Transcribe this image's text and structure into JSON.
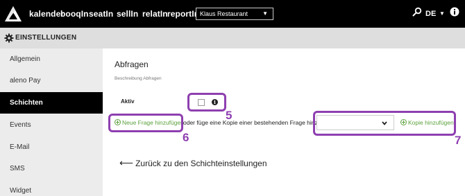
{
  "topbar": {
    "nav": [
      "kalender",
      "booqIn",
      "seatIn",
      "sellIn",
      "relatIn",
      "reportIn"
    ],
    "restaurant": "Klaus Restaurant",
    "language": "DE",
    "icons": [
      "logo-icon",
      "search-icon",
      "chevron-down-icon",
      "info-icon"
    ]
  },
  "subheader": {
    "title": "EINSTELLUNGEN",
    "icon": "gear-icon"
  },
  "sidebar": {
    "items": [
      {
        "label": "Allgemein",
        "active": false
      },
      {
        "label": "aleno Pay",
        "active": false
      },
      {
        "label": "Schichten",
        "active": true
      },
      {
        "label": "Events",
        "active": false
      },
      {
        "label": "E-Mail",
        "active": false
      },
      {
        "label": "SMS",
        "active": false
      },
      {
        "label": "Widget",
        "active": false
      }
    ]
  },
  "main": {
    "title": "Abfragen",
    "subtitle": "Beschreibung Abfragen",
    "aktiv_label": "Aktiv",
    "aktiv_checked": false,
    "add_question": "Neue Frage hinzufügen",
    "copy_text": "oder füge eine Kopie einer bestehenden Frage hinzu:",
    "copy_select_value": "",
    "copy_button": "Kopie hinzufügen",
    "back_link": "Zurück zu den Schichteinstellungen"
  },
  "annotations": [
    {
      "number": "5"
    },
    {
      "number": "6"
    },
    {
      "number": "7"
    }
  ],
  "colors": {
    "accent_green": "#5aa13b",
    "annotation_purple": "#8e3fb0",
    "topbar": "#000000"
  }
}
